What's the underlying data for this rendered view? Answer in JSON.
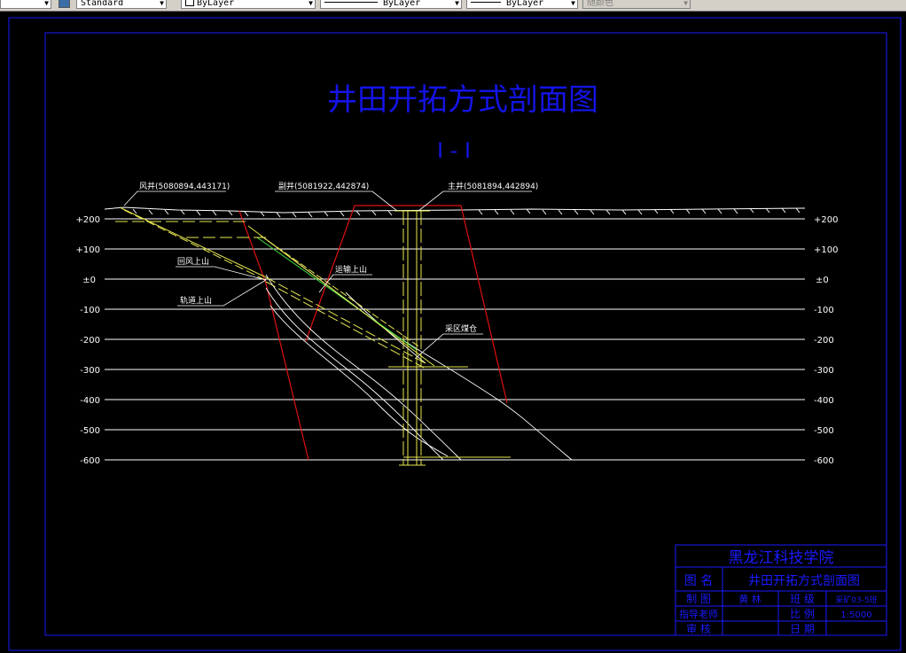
{
  "toolbar": {
    "text_style": "Standard",
    "layer": "ByLayer",
    "linetype": "ByLayer",
    "lineweight": "ByLayer",
    "plot_color": "随颜色"
  },
  "drawing": {
    "title": "井田开拓方式剖面图",
    "section": "I - I",
    "left_levels": [
      "+200",
      "+100",
      "±0",
      "-100",
      "-200",
      "-300",
      "-400",
      "-500",
      "-600"
    ],
    "right_levels": [
      "+200",
      "+100",
      "±0",
      "-100",
      "-200",
      "-300",
      "-400",
      "-500",
      "-600"
    ],
    "shafts": {
      "air": "风井(5080894,443171)",
      "auxiliary": "副井(5081922,442874)",
      "main": "主井(5081894,442894)"
    },
    "labels": {
      "return_air_incline": "回风上山",
      "haulage_incline": "运输上山",
      "track_incline": "轨道上山",
      "district_bunker": "采区煤仓"
    }
  },
  "title_block": {
    "institute": "黑龙江科技学院",
    "drawing_name_label": "图 名",
    "drawing_name": "井田开拓方式剖面图",
    "drawn_by_label": "制 图",
    "drawn_by": "黄 林",
    "class_label": "班 级",
    "class": "采矿03-5班",
    "advisor_label": "指导老师",
    "advisor": "",
    "scale_label": "比 例",
    "scale": "1:5000",
    "review_label": "审 核",
    "reviewer": "",
    "date_label": "日 期",
    "date": ""
  }
}
